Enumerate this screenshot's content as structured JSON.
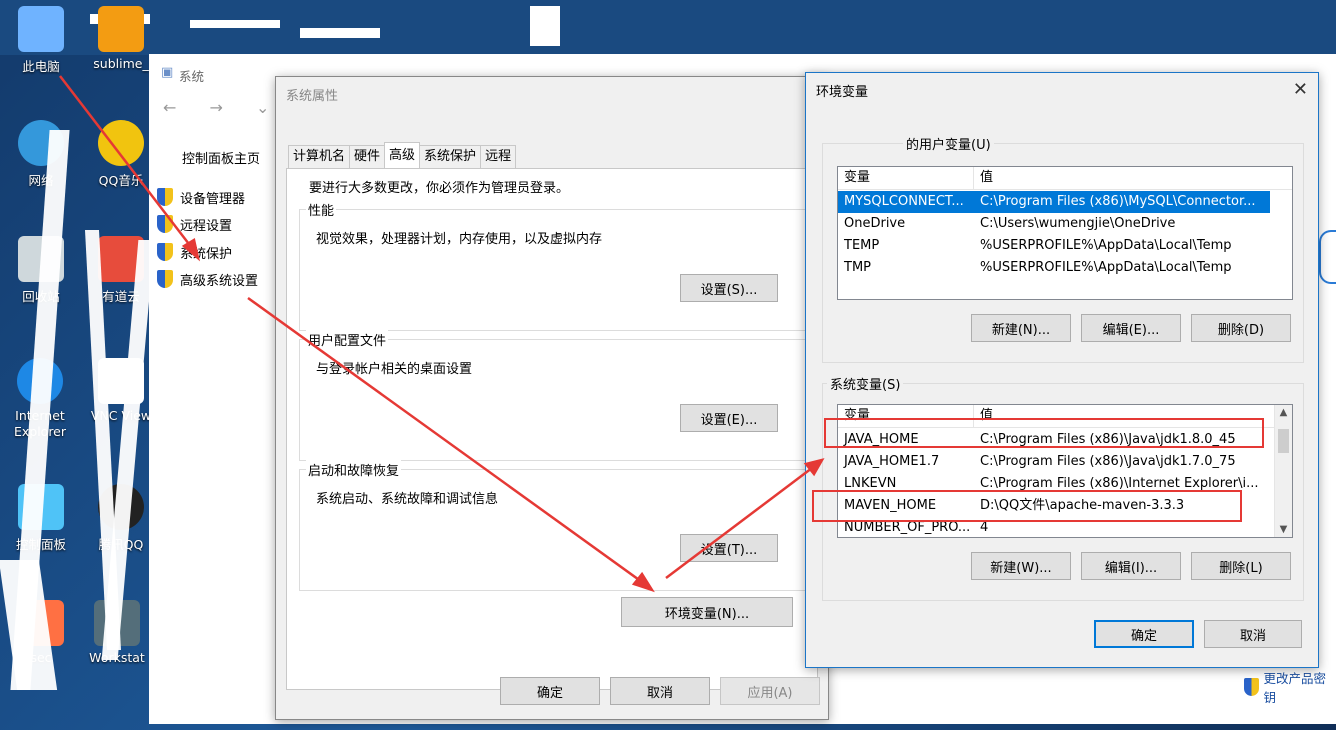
{
  "desktop": {
    "icons": [
      {
        "label": "此电脑",
        "color": "#6fb3ff"
      },
      {
        "label": "sublime_",
        "color": "#f39c12"
      },
      {
        "label": "网络",
        "color": "#3498db"
      },
      {
        "label": "QQ音乐",
        "color": "#f1c40f"
      },
      {
        "label": "回收站",
        "color": "#cfd8dc"
      },
      {
        "label": "有道云",
        "color": "#e74c3c"
      },
      {
        "label": "Internet Explorer",
        "color": "#1e88e5"
      },
      {
        "label": "VNC View",
        "color": "#ffffff"
      },
      {
        "label": "控制面板",
        "color": "#4fc3f7"
      },
      {
        "label": "腾讯QQ",
        "color": "#222222"
      },
      {
        "label": "sec",
        "color": "#ff7043"
      },
      {
        "label": "Workstat",
        "color": "#546e7a"
      }
    ]
  },
  "system_window": {
    "title": "系统",
    "control_panel_home": "控制面板主页",
    "nav": "←  →  ⌄  ↑",
    "links": [
      "设备管理器",
      "远程设置",
      "系统保护",
      "高级系统设置"
    ],
    "change_key": "更改产品密钥"
  },
  "sysprops": {
    "title": "系统属性",
    "tabs": [
      "计算机名",
      "硬件",
      "高级",
      "系统保护",
      "远程"
    ],
    "active_tab": "高级",
    "admin_note": "要进行大多数更改，你必须作为管理员登录。",
    "performance": {
      "label": "性能",
      "desc": "视觉效果，处理器计划，内存使用，以及虚拟内存",
      "button": "设置(S)..."
    },
    "profiles": {
      "label": "用户配置文件",
      "desc": "与登录帐户相关的桌面设置",
      "button": "设置(E)..."
    },
    "startup": {
      "label": "启动和故障恢复",
      "desc": "系统启动、系统故障和调试信息",
      "button": "设置(T)..."
    },
    "env_button": "环境变量(N)...",
    "ok": "确定",
    "cancel": "取消",
    "apply": "应用(A)"
  },
  "envvars": {
    "title": "环境变量",
    "close": "✕",
    "user_section": "的用户变量(U)",
    "col_var": "变量",
    "col_val": "值",
    "user_vars": [
      {
        "name": "MYSQLCONNECT...",
        "value": "C:\\Program Files (x86)\\MySQL\\Connector..."
      },
      {
        "name": "OneDrive",
        "value": "C:\\Users\\wumengjie\\OneDrive"
      },
      {
        "name": "TEMP",
        "value": "%USERPROFILE%\\AppData\\Local\\Temp"
      },
      {
        "name": "TMP",
        "value": "%USERPROFILE%\\AppData\\Local\\Temp"
      }
    ],
    "user_buttons": [
      "新建(N)...",
      "编辑(E)...",
      "删除(D)"
    ],
    "system_section": "系统变量(S)",
    "system_vars": [
      {
        "name": "JAVA_HOME",
        "value": "C:\\Program Files (x86)\\Java\\jdk1.8.0_45"
      },
      {
        "name": "JAVA_HOME1.7",
        "value": "C:\\Program Files (x86)\\Java\\jdk1.7.0_75"
      },
      {
        "name": "LNKEVN",
        "value": "C:\\Program Files (x86)\\Internet Explorer\\i..."
      },
      {
        "name": "MAVEN_HOME",
        "value": "D:\\QQ文件\\apache-maven-3.3.3"
      },
      {
        "name": "NUMBER_OF_PRO...",
        "value": "4"
      }
    ],
    "system_buttons": [
      "新建(W)...",
      "编辑(I)...",
      "删除(L)"
    ],
    "ok": "确定",
    "cancel": "取消"
  },
  "annotation_color": "#e53935"
}
